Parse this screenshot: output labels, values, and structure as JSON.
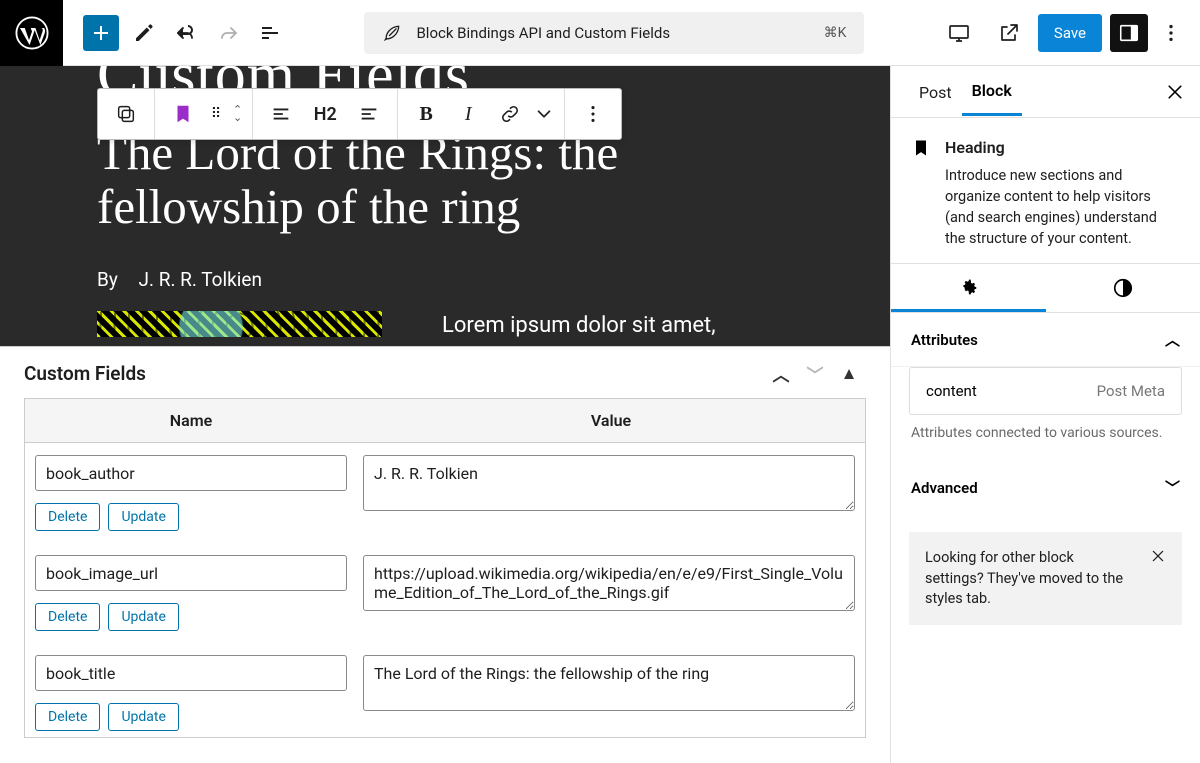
{
  "topbar": {
    "doc_title": "Block Bindings API and Custom Fields",
    "shortcut": "⌘K",
    "save_label": "Save"
  },
  "block_toolbar": {
    "heading_level": "H2"
  },
  "canvas": {
    "partial_title": "Custom Fields",
    "heading": "The Lord of the Rings: the fellowship of the ring",
    "by_label": "By",
    "author": "J. R. R. Tolkien",
    "lorem": "Lorem ipsum dolor sit amet,"
  },
  "custom_fields": {
    "panel_title": "Custom Fields",
    "col_name": "Name",
    "col_value": "Value",
    "delete_label": "Delete",
    "update_label": "Update",
    "rows": [
      {
        "name": "book_author",
        "value": "J. R. R. Tolkien"
      },
      {
        "name": "book_image_url",
        "value": "https://upload.wikimedia.org/wikipedia/en/e/e9/First_Single_Volume_Edition_of_The_Lord_of_the_Rings.gif"
      },
      {
        "name": "book_title",
        "value": "The Lord of the Rings: the fellowship of the ring"
      }
    ]
  },
  "sidebar": {
    "tab_post": "Post",
    "tab_block": "Block",
    "block_name": "Heading",
    "block_desc": "Introduce new sections and organize content to help visitors (and search engines) understand the structure of your content.",
    "section_attributes": "Attributes",
    "attr_key": "content",
    "attr_source": "Post Meta",
    "attr_note": "Attributes connected to various sources.",
    "section_advanced": "Advanced",
    "tip": "Looking for other block settings? They've moved to the styles tab."
  }
}
